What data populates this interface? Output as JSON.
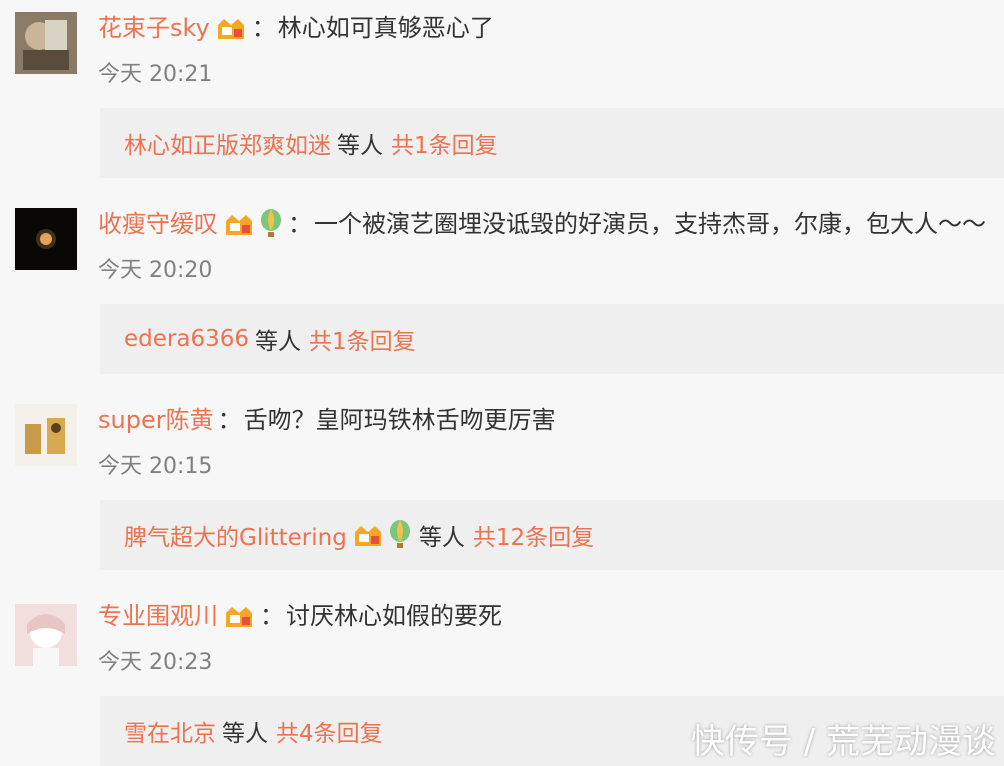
{
  "colors": {
    "username": "#eb7350",
    "text": "#333333",
    "time": "#808080",
    "reply_bg": "#efefef",
    "page_bg": "#f7f7f7"
  },
  "comments": [
    {
      "username": "花束子sky",
      "separator": "：",
      "text": "林心如可真够恶心了",
      "time": "今天 20:21",
      "reply_user": "林心如正版郑爽如迷",
      "reply_mid": "等人",
      "reply_count": "共1条回复",
      "icons": [
        "vip-badge-icon"
      ]
    },
    {
      "username": "收瘦守缓叹",
      "separator": "：",
      "text": "一个被演艺圈埋没诋毁的好演员，支持杰哥，尔康，包大人～～",
      "time": "今天 20:20",
      "reply_user": "edera6366",
      "reply_mid": "等人",
      "reply_count": "共1条回复",
      "icons": [
        "vip-badge-icon",
        "balloon-icon"
      ]
    },
    {
      "username": "super陈黄",
      "separator": "：",
      "text": "舌吻？皇阿玛铁林舌吻更厉害",
      "time": "今天 20:15",
      "reply_user": "脾气超大的Glittering",
      "reply_mid": "等人",
      "reply_count": "共12条回复",
      "icons": []
    },
    {
      "username": "专业围观川",
      "separator": "：",
      "text": "讨厌林心如假的要死",
      "time": "今天 20:23",
      "reply_user": "雪在北京",
      "reply_mid": "等人",
      "reply_count": "共4条回复",
      "icons": [
        "vip-badge-icon"
      ]
    }
  ],
  "watermark": "快传号 / 荒芜动漫谈"
}
